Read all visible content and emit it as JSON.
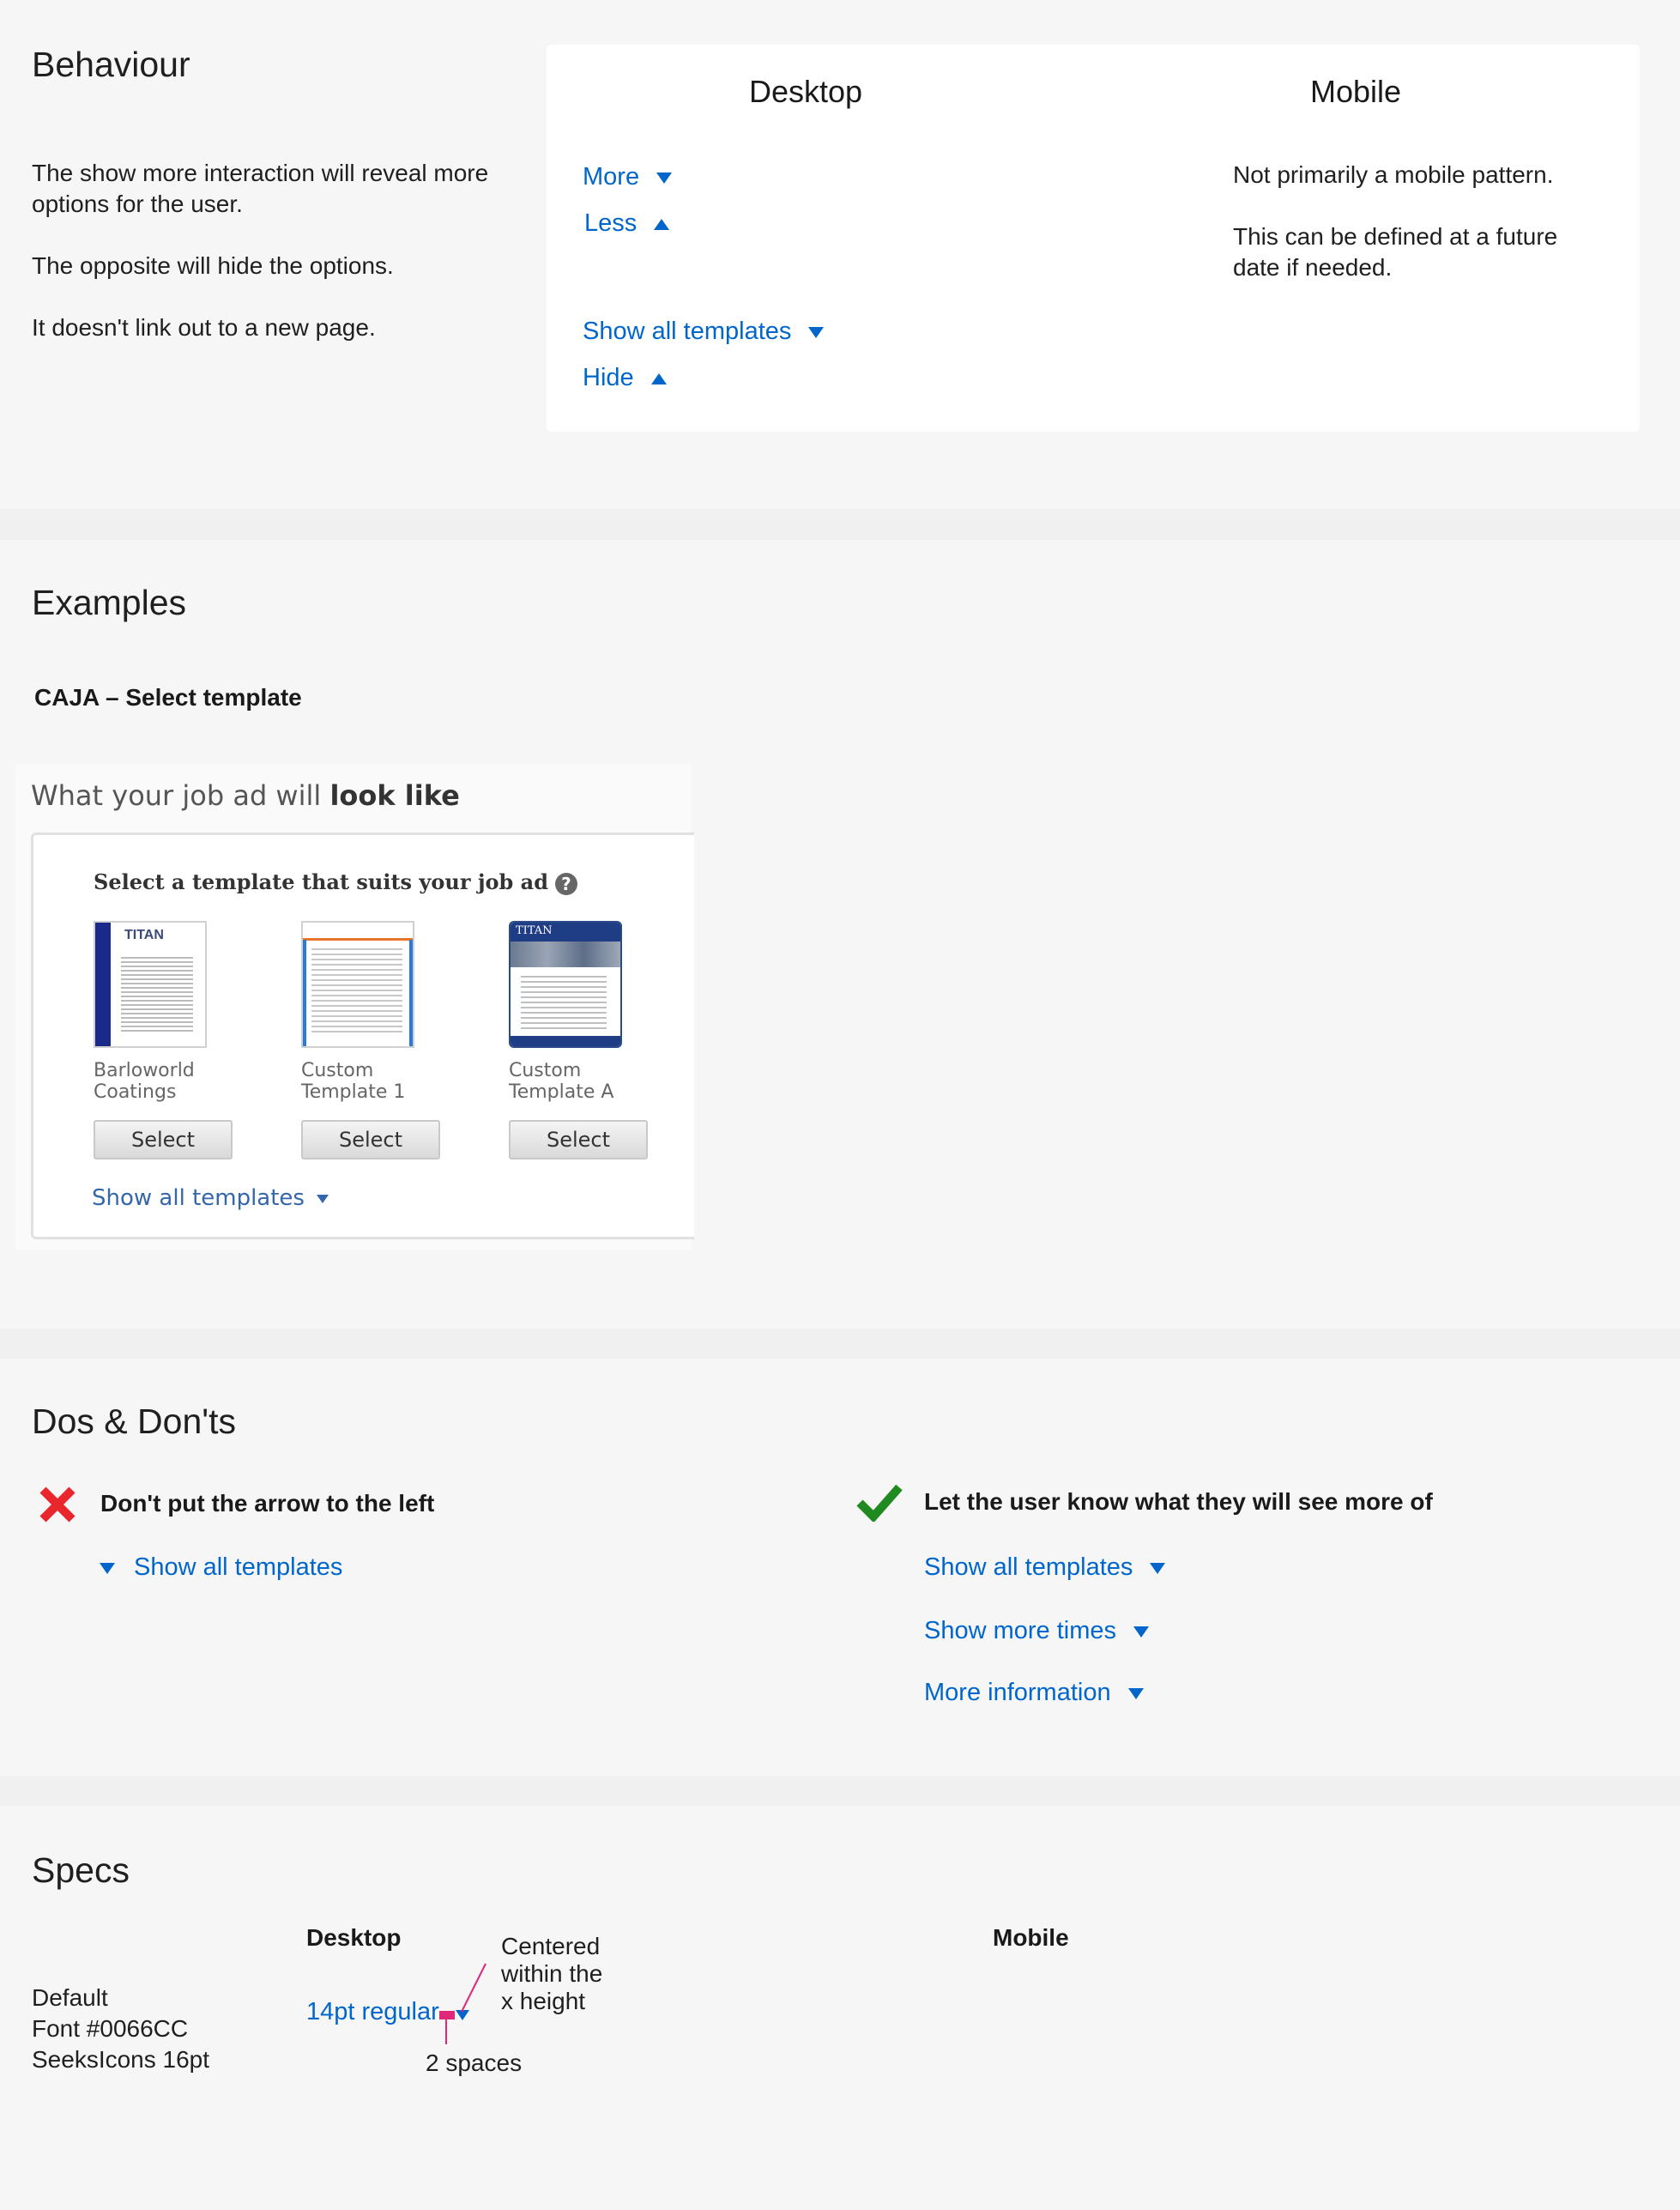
{
  "behaviour": {
    "title": "Behaviour",
    "desc": [
      "The show more interaction will reveal more options for the user.",
      "The opposite will hide the options.",
      "It doesn't link out to a new page."
    ],
    "desktop_header": "Desktop",
    "mobile_header": "Mobile",
    "links": [
      {
        "label": "More",
        "icon": "triangle-down-icon"
      },
      {
        "label": "Less",
        "icon": "triangle-up-icon"
      },
      {
        "label": "Show all templates",
        "icon": "triangle-down-icon"
      },
      {
        "label": "Hide",
        "icon": "triangle-up-icon"
      }
    ],
    "mobile_text": [
      "Not primarily a mobile pattern.",
      "This can be defined at a future date if needed."
    ]
  },
  "examples": {
    "title": "Examples",
    "subtitle": "CAJA – Select template",
    "widget": {
      "heading_normal": "What your job ad will ",
      "heading_bold": "look like",
      "instruction": "Select a template that suits your job ad",
      "help_icon": "question-circle-icon",
      "templates": [
        {
          "name_line1": "Barloworld",
          "name_line2": "Coatings",
          "button": "Select"
        },
        {
          "name_line1": "Custom",
          "name_line2": "Template 1",
          "button": "Select"
        },
        {
          "name_line1": "Custom",
          "name_line2": "Template A",
          "button": "Select"
        }
      ],
      "thumb_texts": {
        "logo": "TITAN",
        "logo_small": "TITAN"
      },
      "show_all": "Show all templates"
    }
  },
  "dos": {
    "title": "Dos & Don'ts",
    "dont_label": "Don't put the arrow to the left",
    "dont_example": "Show all templates",
    "do_label": "Let the user know what they will see more of",
    "do_examples": [
      "Show all templates",
      "Show more times",
      "More information"
    ],
    "colors": {
      "dont": "#e8262b",
      "do": "#1f8a1f"
    }
  },
  "specs": {
    "title": "Specs",
    "desktop_header": "Desktop",
    "mobile_header": "Mobile",
    "default_lines": [
      "Default",
      "Font #0066CC",
      "SeeksIcons 16pt"
    ],
    "sample": "14pt regular",
    "annotation_center": [
      "Centered",
      "within the",
      "x height"
    ],
    "annotation_spaces": "2 spaces",
    "colors": {
      "link": "#0066CC",
      "annotation": "#e0287a"
    }
  }
}
